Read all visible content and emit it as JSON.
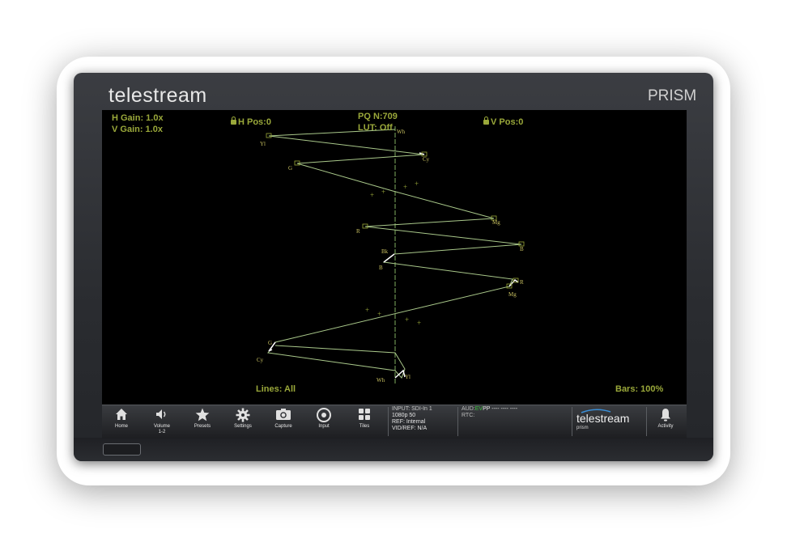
{
  "device": {
    "brand": "telestream",
    "product": "PRISM"
  },
  "overlay": {
    "h_gain": "H Gain: 1.0x",
    "v_gain": "V Gain: 1.0x",
    "h_pos": "H Pos:0",
    "v_pos": "V Pos:0",
    "pq": "PQ N:709",
    "lut": "LUT: Off",
    "lines": "Lines: All",
    "bars": "Bars: 100%"
  },
  "trace_labels": {
    "wh_top": "Wh",
    "yl_top": "Yl",
    "cy_top": "Cy",
    "g_top": "G",
    "mg_top": "Mg",
    "r_top": "R",
    "b_top": "B",
    "bk": "Bk",
    "b_bot": "B",
    "r_bot": "R",
    "mg_bot": "Mg",
    "g_bot": "G",
    "cy_bot": "Cy",
    "wh_bot": "Wh",
    "yl_bot": "Yl"
  },
  "toolbar": {
    "home": "Home",
    "volume": "Volume",
    "volume_sub": "1-2",
    "presets": "Presets",
    "settings": "Settings",
    "capture": "Capture",
    "input": "Input",
    "tiles": "Tiles",
    "activity": "Activity"
  },
  "status": {
    "input": "INPUT: SDI-In 1",
    "format": "1080p 50",
    "ref": "REF: Internal",
    "vidref": "VID/REF: N/A",
    "aud_prefix": "AUD:",
    "aud_ev": "EV",
    "aud_rest": "PP ---- ---- ----",
    "rtc": "RTC:"
  },
  "footer_brand": {
    "name": "telestream",
    "sub": "prism"
  },
  "colors": {
    "overlay_text": "#9aa83a",
    "trace": "#a9c88a",
    "aud_ev": "#3fbf3f"
  },
  "icons": {
    "home": "home-icon",
    "volume": "speaker-icon",
    "presets": "star-icon",
    "settings": "gear-icon",
    "capture": "camera-icon",
    "input": "input-dial-icon",
    "tiles": "tiles-icon",
    "activity": "bell-icon",
    "lock": "lock-icon"
  }
}
